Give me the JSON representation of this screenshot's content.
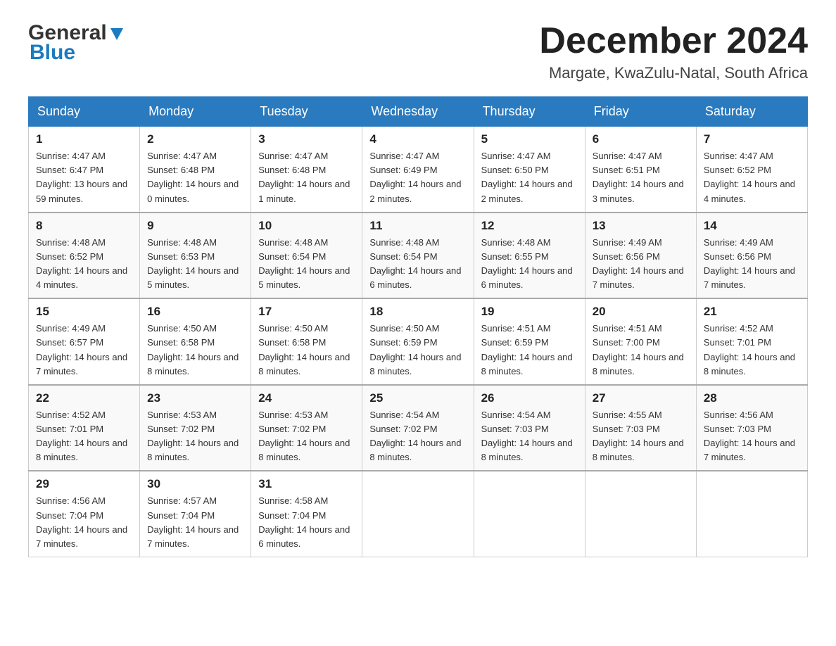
{
  "header": {
    "logo_general": "General",
    "logo_blue": "Blue",
    "month_title": "December 2024",
    "location": "Margate, KwaZulu-Natal, South Africa"
  },
  "days_of_week": [
    "Sunday",
    "Monday",
    "Tuesday",
    "Wednesday",
    "Thursday",
    "Friday",
    "Saturday"
  ],
  "weeks": [
    [
      {
        "day": "1",
        "sunrise": "4:47 AM",
        "sunset": "6:47 PM",
        "daylight": "13 hours and 59 minutes."
      },
      {
        "day": "2",
        "sunrise": "4:47 AM",
        "sunset": "6:48 PM",
        "daylight": "14 hours and 0 minutes."
      },
      {
        "day": "3",
        "sunrise": "4:47 AM",
        "sunset": "6:48 PM",
        "daylight": "14 hours and 1 minute."
      },
      {
        "day": "4",
        "sunrise": "4:47 AM",
        "sunset": "6:49 PM",
        "daylight": "14 hours and 2 minutes."
      },
      {
        "day": "5",
        "sunrise": "4:47 AM",
        "sunset": "6:50 PM",
        "daylight": "14 hours and 2 minutes."
      },
      {
        "day": "6",
        "sunrise": "4:47 AM",
        "sunset": "6:51 PM",
        "daylight": "14 hours and 3 minutes."
      },
      {
        "day": "7",
        "sunrise": "4:47 AM",
        "sunset": "6:52 PM",
        "daylight": "14 hours and 4 minutes."
      }
    ],
    [
      {
        "day": "8",
        "sunrise": "4:48 AM",
        "sunset": "6:52 PM",
        "daylight": "14 hours and 4 minutes."
      },
      {
        "day": "9",
        "sunrise": "4:48 AM",
        "sunset": "6:53 PM",
        "daylight": "14 hours and 5 minutes."
      },
      {
        "day": "10",
        "sunrise": "4:48 AM",
        "sunset": "6:54 PM",
        "daylight": "14 hours and 5 minutes."
      },
      {
        "day": "11",
        "sunrise": "4:48 AM",
        "sunset": "6:54 PM",
        "daylight": "14 hours and 6 minutes."
      },
      {
        "day": "12",
        "sunrise": "4:48 AM",
        "sunset": "6:55 PM",
        "daylight": "14 hours and 6 minutes."
      },
      {
        "day": "13",
        "sunrise": "4:49 AM",
        "sunset": "6:56 PM",
        "daylight": "14 hours and 7 minutes."
      },
      {
        "day": "14",
        "sunrise": "4:49 AM",
        "sunset": "6:56 PM",
        "daylight": "14 hours and 7 minutes."
      }
    ],
    [
      {
        "day": "15",
        "sunrise": "4:49 AM",
        "sunset": "6:57 PM",
        "daylight": "14 hours and 7 minutes."
      },
      {
        "day": "16",
        "sunrise": "4:50 AM",
        "sunset": "6:58 PM",
        "daylight": "14 hours and 8 minutes."
      },
      {
        "day": "17",
        "sunrise": "4:50 AM",
        "sunset": "6:58 PM",
        "daylight": "14 hours and 8 minutes."
      },
      {
        "day": "18",
        "sunrise": "4:50 AM",
        "sunset": "6:59 PM",
        "daylight": "14 hours and 8 minutes."
      },
      {
        "day": "19",
        "sunrise": "4:51 AM",
        "sunset": "6:59 PM",
        "daylight": "14 hours and 8 minutes."
      },
      {
        "day": "20",
        "sunrise": "4:51 AM",
        "sunset": "7:00 PM",
        "daylight": "14 hours and 8 minutes."
      },
      {
        "day": "21",
        "sunrise": "4:52 AM",
        "sunset": "7:01 PM",
        "daylight": "14 hours and 8 minutes."
      }
    ],
    [
      {
        "day": "22",
        "sunrise": "4:52 AM",
        "sunset": "7:01 PM",
        "daylight": "14 hours and 8 minutes."
      },
      {
        "day": "23",
        "sunrise": "4:53 AM",
        "sunset": "7:02 PM",
        "daylight": "14 hours and 8 minutes."
      },
      {
        "day": "24",
        "sunrise": "4:53 AM",
        "sunset": "7:02 PM",
        "daylight": "14 hours and 8 minutes."
      },
      {
        "day": "25",
        "sunrise": "4:54 AM",
        "sunset": "7:02 PM",
        "daylight": "14 hours and 8 minutes."
      },
      {
        "day": "26",
        "sunrise": "4:54 AM",
        "sunset": "7:03 PM",
        "daylight": "14 hours and 8 minutes."
      },
      {
        "day": "27",
        "sunrise": "4:55 AM",
        "sunset": "7:03 PM",
        "daylight": "14 hours and 8 minutes."
      },
      {
        "day": "28",
        "sunrise": "4:56 AM",
        "sunset": "7:03 PM",
        "daylight": "14 hours and 7 minutes."
      }
    ],
    [
      {
        "day": "29",
        "sunrise": "4:56 AM",
        "sunset": "7:04 PM",
        "daylight": "14 hours and 7 minutes."
      },
      {
        "day": "30",
        "sunrise": "4:57 AM",
        "sunset": "7:04 PM",
        "daylight": "14 hours and 7 minutes."
      },
      {
        "day": "31",
        "sunrise": "4:58 AM",
        "sunset": "7:04 PM",
        "daylight": "14 hours and 6 minutes."
      },
      null,
      null,
      null,
      null
    ]
  ]
}
